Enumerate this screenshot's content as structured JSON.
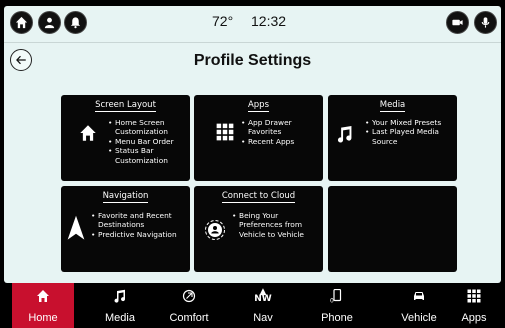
{
  "status_bar": {
    "temperature": "72°",
    "time": "12:32",
    "left_icons": [
      "home-icon",
      "profile-icon",
      "notification-bell-icon"
    ],
    "right_icons": [
      "camera-icon",
      "microphone-icon"
    ]
  },
  "header": {
    "back_icon": "back-arrow-icon",
    "title": "Profile Settings"
  },
  "tiles": [
    {
      "title": "Screen Layout",
      "icon": "home-icon",
      "items": [
        "Home Screen Customization",
        "Menu Bar Order",
        "Status Bar Customization"
      ]
    },
    {
      "title": "Apps",
      "icon": "app-grid-icon",
      "items": [
        "App Drawer Favorites",
        "Recent Apps"
      ]
    },
    {
      "title": "Media",
      "icon": "music-note-icon",
      "items": [
        "Your Mixed Presets",
        "Last Played Media Source"
      ]
    },
    {
      "title": "Navigation",
      "icon": "navigation-arrow-icon",
      "items": [
        "Favorite and Recent Destinations",
        "Predictive Navigation"
      ]
    },
    {
      "title": "Connect to Cloud",
      "icon": "cloud-profile-icon",
      "items": [
        "Being Your Preferences from Vehicle to Vehicle"
      ]
    }
  ],
  "bottom_nav": {
    "items": [
      {
        "label": "Home",
        "icon": "home-icon",
        "active": true
      },
      {
        "label": "Media",
        "icon": "music-note-icon",
        "active": false
      },
      {
        "label": "Comfort",
        "icon": "climate-icon",
        "active": false
      },
      {
        "label": "Nav",
        "icon": "compass-icon",
        "active": false,
        "icon_text": "N\nW"
      },
      {
        "label": "Phone",
        "icon": "phone-icon",
        "active": false,
        "icon_text": "0"
      },
      {
        "label": "Vehicle",
        "icon": "car-icon",
        "active": false
      },
      {
        "label": "Apps",
        "icon": "app-grid-icon",
        "active": false
      }
    ]
  },
  "colors": {
    "background": "#e7f4f3",
    "tile": "#070707",
    "accent_active": "#c8102e",
    "nav_background": "#000000"
  }
}
